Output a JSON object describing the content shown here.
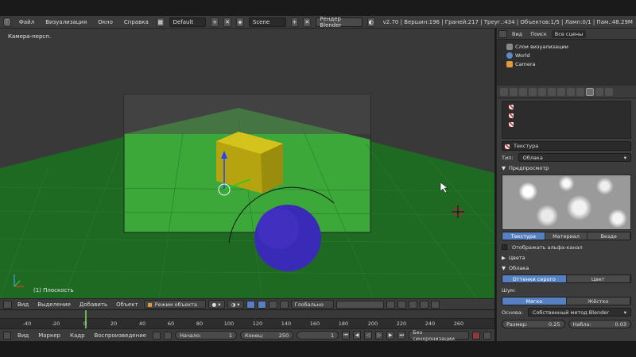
{
  "topbar": {
    "menus": [
      "Файл",
      "Визуализация",
      "Окно",
      "Справка"
    ],
    "screen_layout": "Default",
    "scene": "Scene",
    "renderer": "Рендер Blender",
    "stats": "v2.70 | Вершин:196 | Граней:217 | Треуг.:434 | Объектов:1/5 | Ламп:0/1 | Пам.:48.29M"
  },
  "viewport": {
    "camera_label": "Камера-персп.",
    "object_label": "(1) Плоскость"
  },
  "viewport_header": {
    "menus": [
      "Вид",
      "Выделение",
      "Добавить",
      "Объект"
    ],
    "mode": "Режим объекта",
    "orientation": "Глобально"
  },
  "timeline": {
    "ticks": [
      "-40",
      "-20",
      "0",
      "20",
      "40",
      "60",
      "80",
      "100",
      "120",
      "140",
      "160",
      "180",
      "200",
      "220",
      "240",
      "260"
    ]
  },
  "timeline_header": {
    "menus": [
      "Вид",
      "Маркер",
      "Кадр",
      "Воспроизведение"
    ],
    "start_label": "Начало:",
    "start_value": "1",
    "end_label": "Конец:",
    "end_value": "250",
    "current_frame": "1",
    "sync": "Без синхронизации"
  },
  "outliner": {
    "tabs": [
      "Вид",
      "Поиск",
      "Все сцены"
    ],
    "items": [
      "Слои визуализации",
      "World",
      "Camera"
    ]
  },
  "properties": {
    "texture_name": "Текстура",
    "type_label": "Тип:",
    "type_value": "Облака",
    "preview_header": "Предпросмотр",
    "preview_tabs": [
      "Текстура",
      "Материал",
      "Везде"
    ],
    "alpha_label": "Отображать альфа-канал",
    "colors_header": "Цвета",
    "clouds_header": "Облака",
    "color_modes": [
      "Оттенки серого",
      "Цвет"
    ],
    "noise_label": "Шум:",
    "noise_modes": [
      "Мягко",
      "Жёстко"
    ],
    "basis_label": "Основа:",
    "basis_value": "Собственный метод Blender",
    "size_label": "Размер:",
    "size_value": "0.25",
    "depth_label": "Набла:",
    "depth_value": "0.03"
  },
  "colors": {
    "accent": "#5680c2",
    "ground": "#3ca83a",
    "cube": "#c9b915",
    "sphere": "#3a2ab8"
  }
}
